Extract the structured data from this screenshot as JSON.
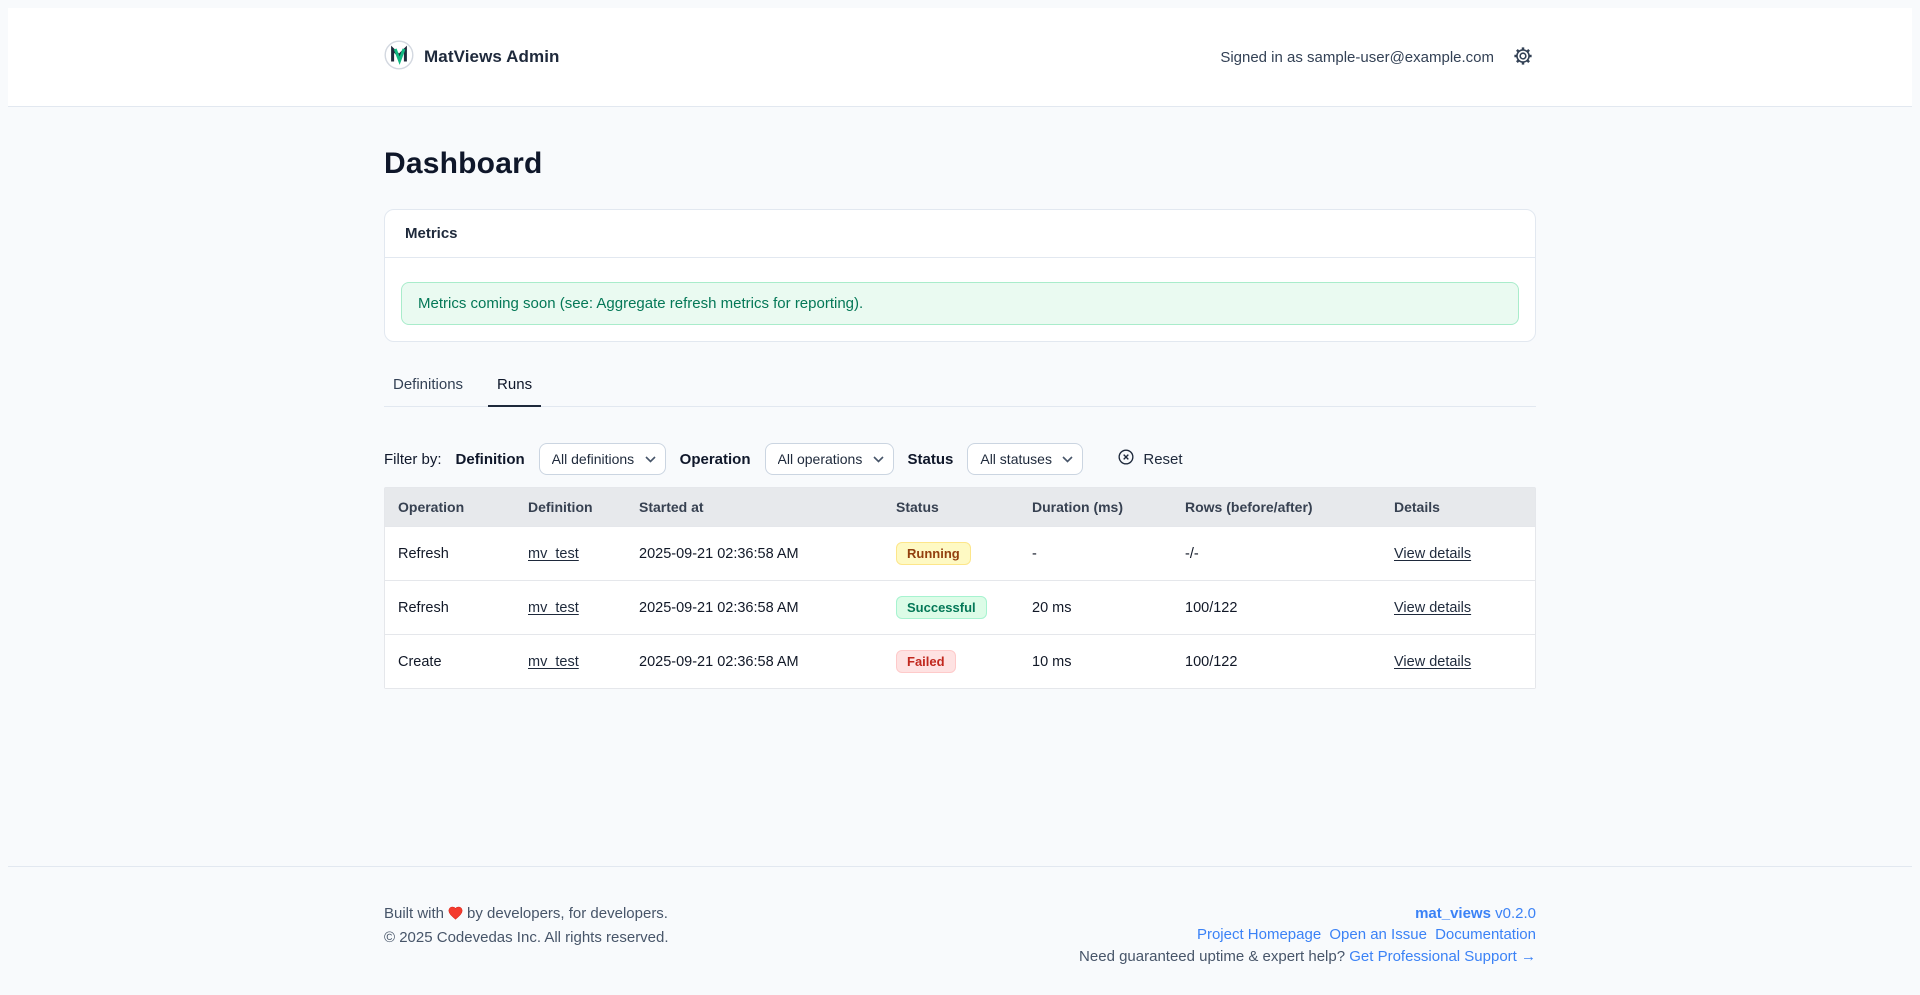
{
  "header": {
    "app_title": "MatViews Admin",
    "signed_in": "Signed in as sample-user@example.com"
  },
  "page": {
    "title": "Dashboard"
  },
  "metrics_card": {
    "title": "Metrics",
    "notice": "Metrics coming soon (see: Aggregate refresh metrics for reporting)."
  },
  "tabs": [
    {
      "label": "Definitions",
      "active": false
    },
    {
      "label": "Runs",
      "active": true
    }
  ],
  "filters": {
    "label": "Filter by:",
    "definition_label": "Definition",
    "definition_value": "All definitions",
    "operation_label": "Operation",
    "operation_value": "All operations",
    "status_label": "Status",
    "status_value": "All statuses",
    "reset_label": "Reset"
  },
  "runs_table": {
    "columns": [
      "Operation",
      "Definition",
      "Started at",
      "Status",
      "Duration (ms)",
      "Rows (before/after)",
      "Details"
    ],
    "rows": [
      {
        "operation": "Refresh",
        "definition": "mv_test",
        "started_at": "2025-09-21 02:36:58 AM",
        "status": "Running",
        "duration": "-",
        "rows": "-/-",
        "details": "View details"
      },
      {
        "operation": "Refresh",
        "definition": "mv_test",
        "started_at": "2025-09-21 02:36:58 AM",
        "status": "Successful",
        "duration": "20 ms",
        "rows": "100/122",
        "details": "View details"
      },
      {
        "operation": "Create",
        "definition": "mv_test",
        "started_at": "2025-09-21 02:36:58 AM",
        "status": "Failed",
        "duration": "10 ms",
        "rows": "100/122",
        "details": "View details"
      }
    ]
  },
  "footer": {
    "built_with_prefix": "Built with",
    "built_with_suffix": "by developers, for developers.",
    "copyright": "© 2025 Codevedas Inc. All rights reserved.",
    "project_name": "mat_views",
    "version": "v0.2.0",
    "links": [
      "Project Homepage",
      "Open an Issue",
      "Documentation"
    ],
    "support_prefix": "Need guaranteed uptime & expert help?",
    "support_link": "Get Professional Support →"
  },
  "colors": {
    "page_bg": "#f8fafc",
    "accent_blue": "#3b82f6",
    "notice_bg": "#eafaf1",
    "notice_text": "#047857",
    "badge_running_text": "#92400e",
    "badge_successful_text": "#047857",
    "badge_failed_text": "#c1281e",
    "brand_green": "#10b981",
    "brand_navy": "#1e293b"
  }
}
